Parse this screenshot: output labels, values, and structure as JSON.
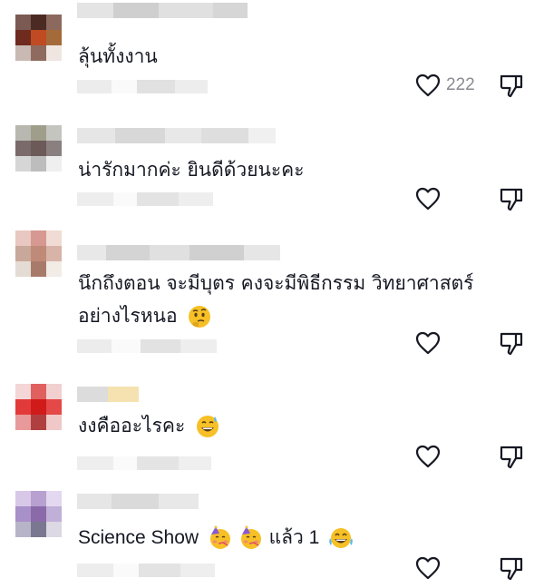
{
  "comments": [
    {
      "text": "ลุ้นทั้งงาน",
      "likes": "222"
    },
    {
      "text": "น่ารักมากค่ะ ยินดีด้วยนะคะ",
      "likes": ""
    },
    {
      "text_line1": "นึกถึงตอน จะมีบุตร คงจะมีพิธีกรรม วิทยาศาสตร์",
      "text_line2": "อย่างไรหนอ",
      "likes": ""
    },
    {
      "text": "งงคืออะไรคะ",
      "likes": ""
    },
    {
      "text_before": "Science Show",
      "text_after": "แล้ว 1",
      "likes": ""
    }
  ],
  "icons": {
    "like": "heart-outline-icon",
    "dislike": "thumbs-down-outline-icon",
    "emoji_thinking": "thinking-face-emoji",
    "emoji_sweat": "grinning-sweat-emoji",
    "emoji_party": "partying-face-emoji",
    "emoji_laugh": "tears-of-joy-emoji"
  },
  "colors": {
    "text": "#161823",
    "icon": "#8a8b91",
    "background": "#ffffff"
  }
}
